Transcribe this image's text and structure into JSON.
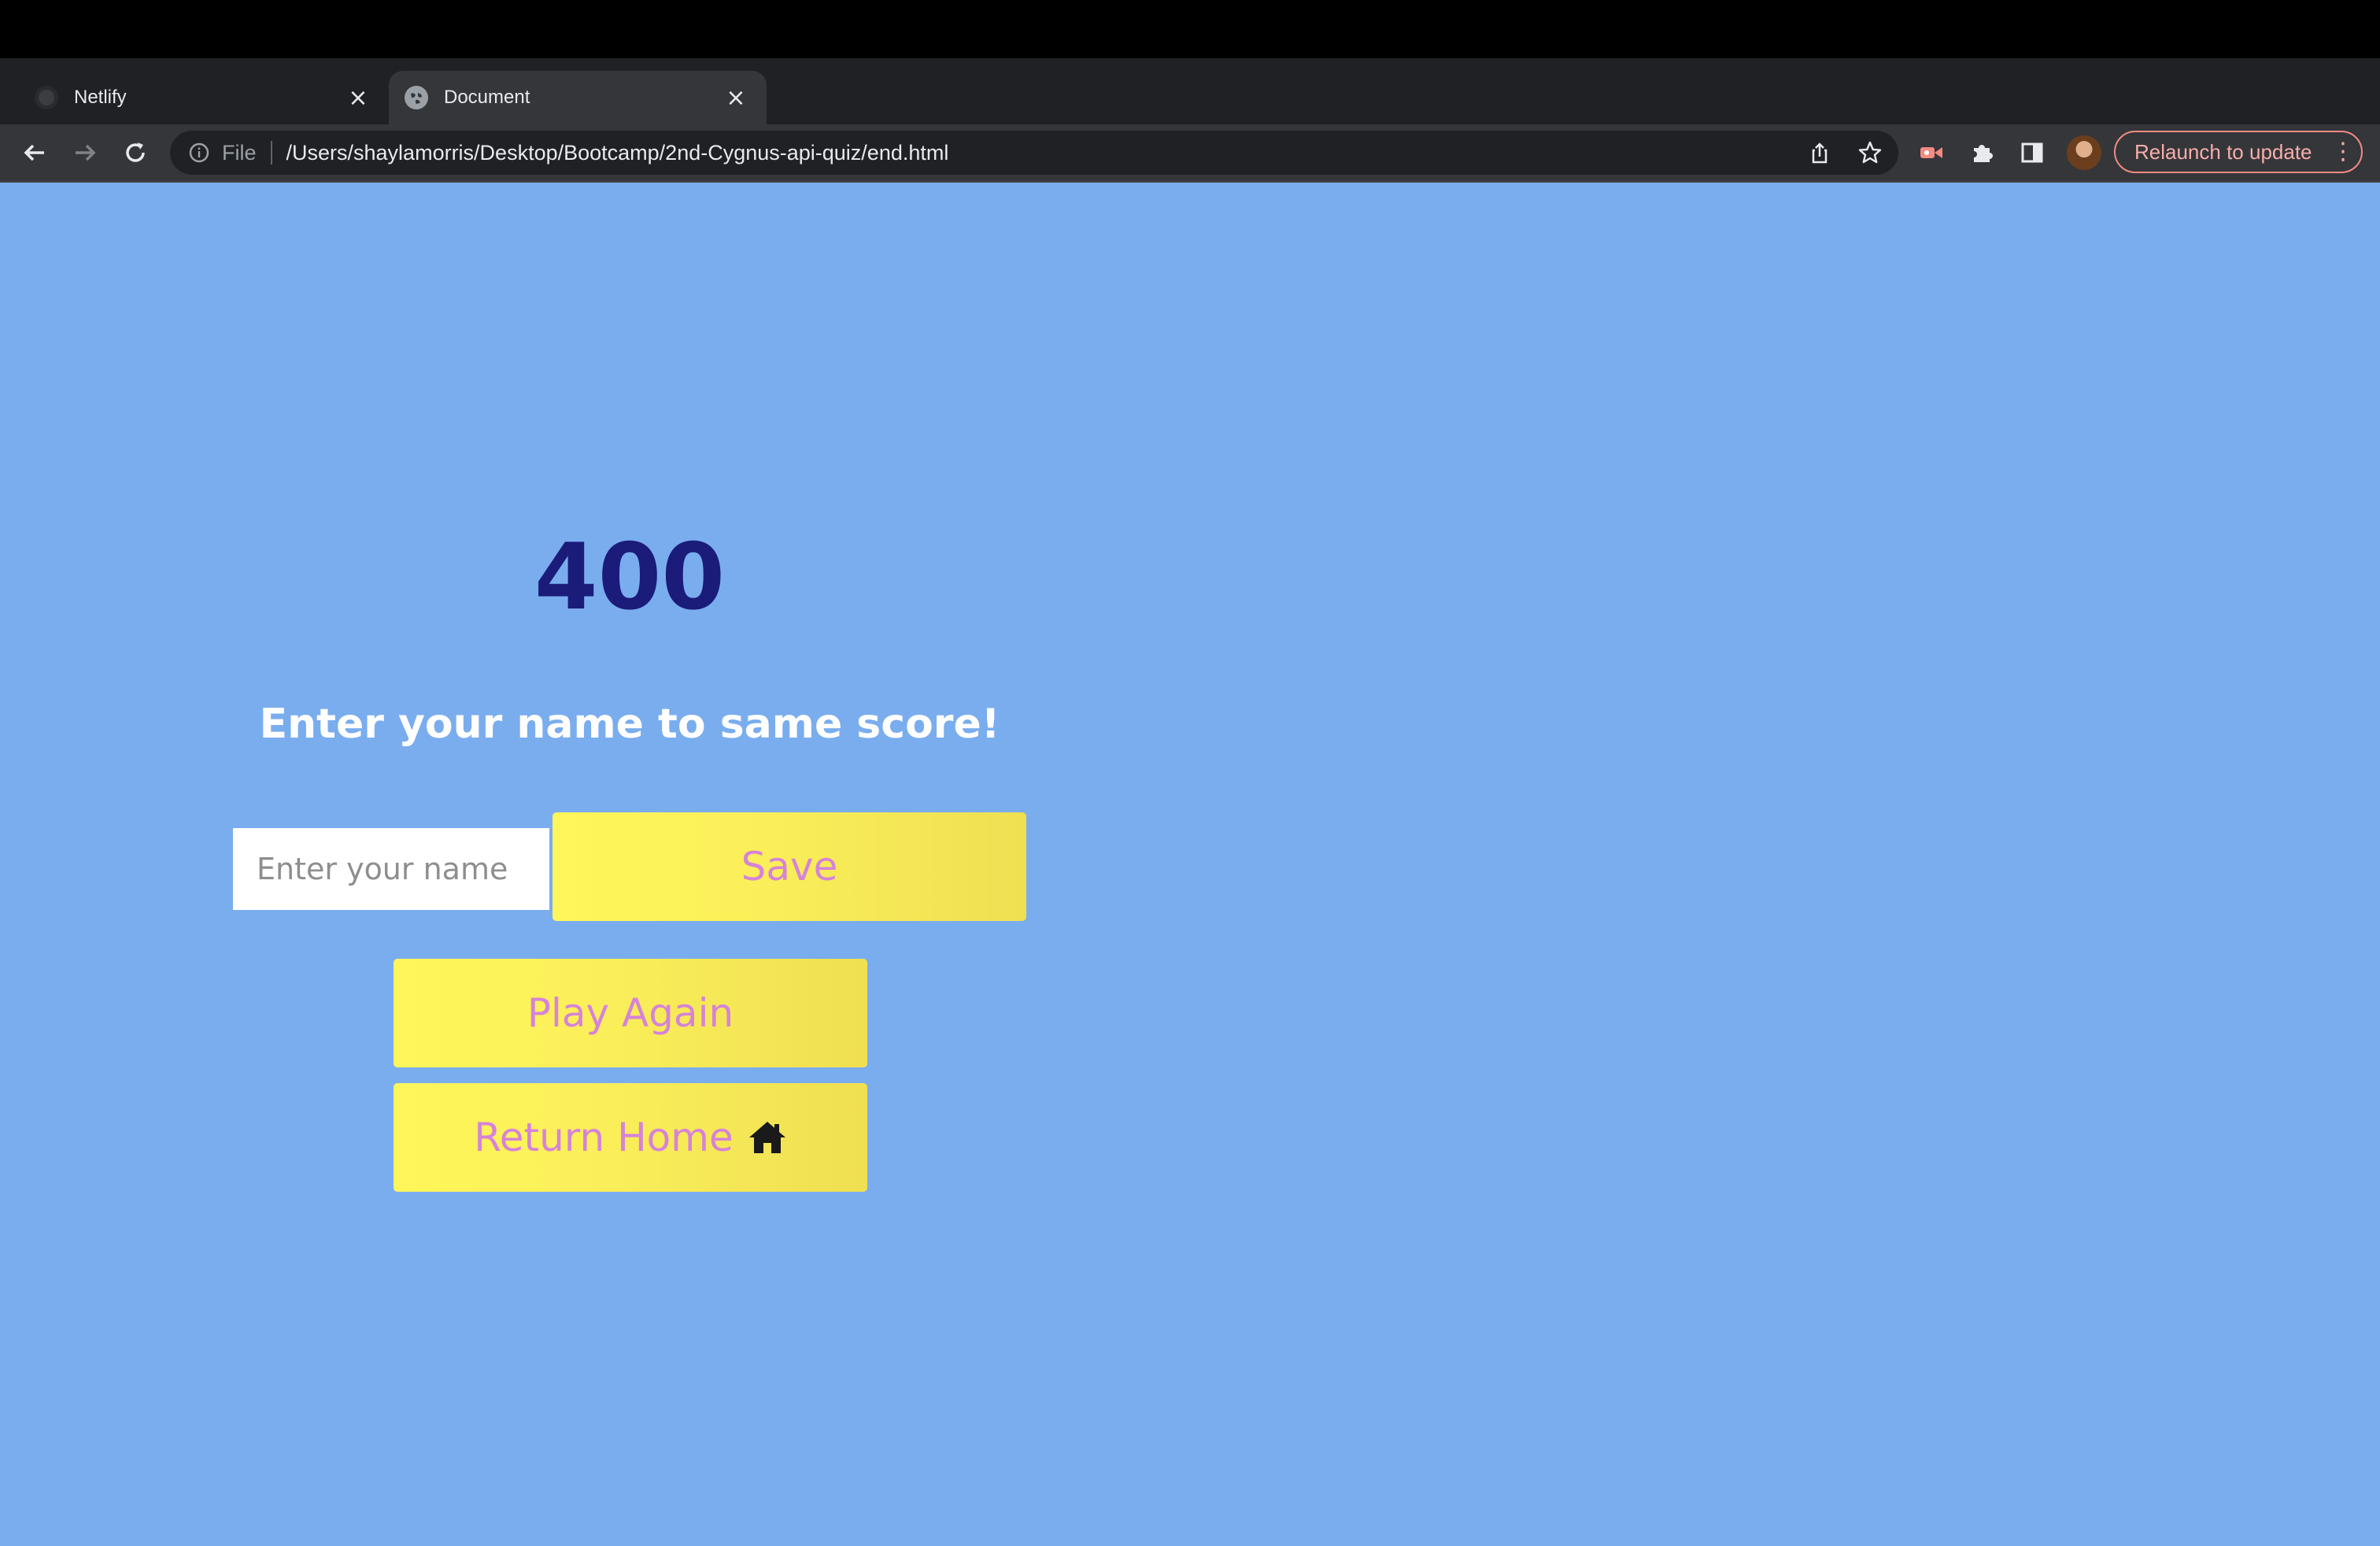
{
  "browser": {
    "tabs": [
      {
        "title": "Netlify",
        "favicon": "github-icon",
        "active": false
      },
      {
        "title": "Document",
        "favicon": "globe-icon",
        "active": true
      }
    ],
    "address": {
      "scheme_label": "File",
      "url": "/Users/shaylamorris/Desktop/Bootcamp/2nd-Cygnus-api-quiz/end.html"
    },
    "relaunch_label": "Relaunch to update",
    "accent_color": "#f28b82"
  },
  "page": {
    "background_color": "#7aadee",
    "score": "400",
    "prompt": "Enter your name to same score!",
    "name_input": {
      "placeholder": "Enter your name",
      "value": ""
    },
    "save_label": "Save",
    "play_again_label": "Play Again",
    "return_home_label": "Return Home",
    "home_icon": "home-icon",
    "button_text_color": "#d683d8",
    "button_color": "#fef65a",
    "score_color": "#1b1b7a"
  }
}
